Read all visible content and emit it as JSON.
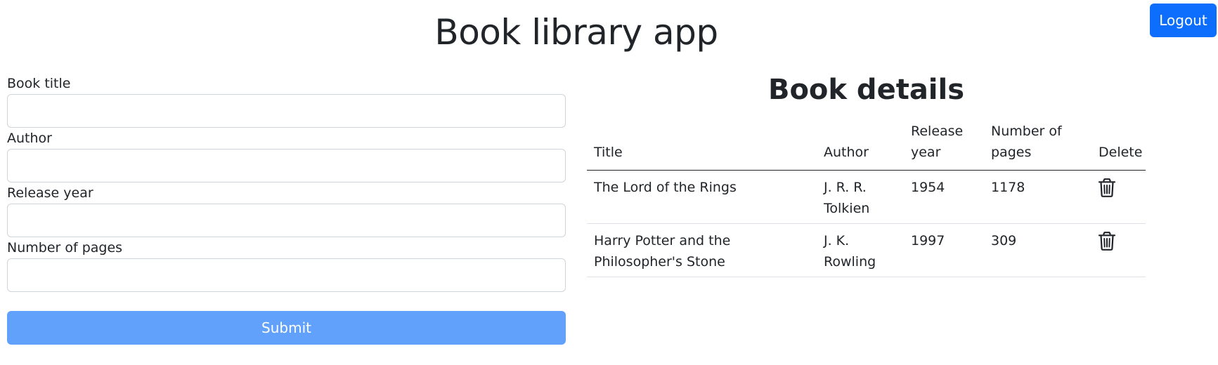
{
  "header": {
    "title": "Book library app",
    "logout_label": "Logout"
  },
  "form": {
    "fields": [
      {
        "label": "Book title",
        "value": "",
        "placeholder": ""
      },
      {
        "label": "Author",
        "value": "",
        "placeholder": ""
      },
      {
        "label": "Release year",
        "value": "",
        "placeholder": ""
      },
      {
        "label": "Number of pages",
        "value": "",
        "placeholder": ""
      }
    ],
    "submit_label": "Submit"
  },
  "details": {
    "title": "Book details",
    "columns": [
      "Title",
      "Author",
      "Release year",
      "Number of pages",
      "Delete"
    ],
    "rows": [
      {
        "title": "The Lord of the Rings",
        "author": "J. R. R. Tolkien",
        "year": "1954",
        "pages": "1178",
        "delete_icon": "trash-icon"
      },
      {
        "title": "Harry Potter and the Philosopher's Stone",
        "author": "J. K. Rowling",
        "year": "1997",
        "pages": "309",
        "delete_icon": "trash-icon"
      }
    ]
  },
  "colors": {
    "primary": "#0d6efd",
    "primary_disabled": "#61a1fc",
    "text": "#212529",
    "border": "#ced4da"
  }
}
